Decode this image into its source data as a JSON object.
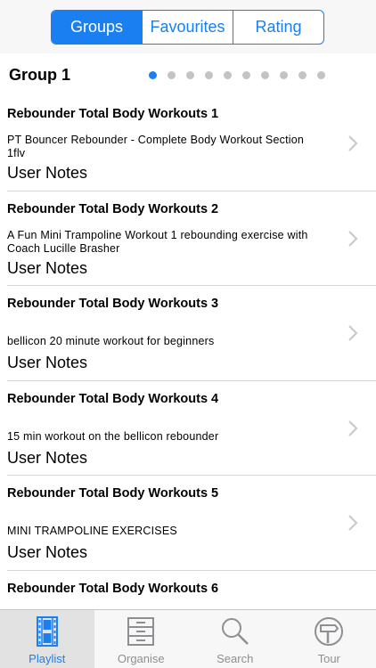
{
  "segments": [
    {
      "label": "Groups",
      "active": true
    },
    {
      "label": "Favourites",
      "active": false
    },
    {
      "label": "Rating",
      "active": false
    }
  ],
  "group": {
    "title": "Group 1",
    "page_count": 10,
    "current_page": 1
  },
  "playlist": [
    {
      "title": "Rebounder Total Body Workouts 1",
      "desc": "PT Bouncer Rebounder - Complete Body Workout Section 1flv",
      "notes": "User Notes"
    },
    {
      "title": "Rebounder Total Body Workouts 2",
      "desc": "A Fun Mini Trampoline Workout  1 rebounding exercise with Coach Lucille Brasher",
      "notes": "User Notes"
    },
    {
      "title": "Rebounder Total Body Workouts 3",
      "desc": "bellicon 20 minute workout for beginners",
      "notes": "User Notes"
    },
    {
      "title": "Rebounder Total Body Workouts 4",
      "desc": "15 min workout on the bellicon rebounder",
      "notes": "User Notes"
    },
    {
      "title": "Rebounder Total Body Workouts 5",
      "desc": "MINI TRAMPOLINE EXERCISES",
      "notes": "User Notes"
    },
    {
      "title": "Rebounder Total Body Workouts 6",
      "desc": "",
      "notes": ""
    }
  ],
  "tabs": [
    {
      "label": "Playlist",
      "icon": "film-strip-icon",
      "active": true
    },
    {
      "label": "Organise",
      "icon": "filing-cabinet-icon",
      "active": false
    },
    {
      "label": "Search",
      "icon": "magnifier-icon",
      "active": false
    },
    {
      "label": "Tour",
      "icon": "signpost-icon",
      "active": false
    }
  ],
  "colors": {
    "accent": "#1a7ff0",
    "inactive": "#8e8e93"
  }
}
